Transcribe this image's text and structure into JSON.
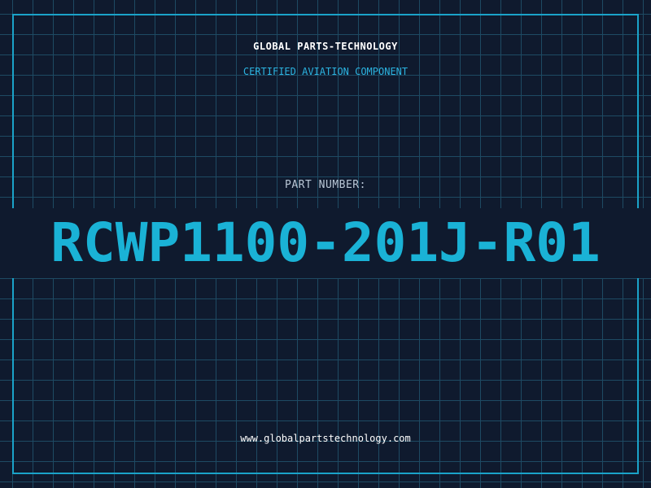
{
  "header": {
    "company": "GLOBAL PARTS-TECHNOLOGY",
    "subtitle": "CERTIFIED AVIATION COMPONENT"
  },
  "part": {
    "label": "PART NUMBER:",
    "number": "RCWP1100-201J-R01"
  },
  "footer": {
    "website": "www.globalpartstechnology.com"
  },
  "colors": {
    "background": "#0f1a2e",
    "grid": "#1e4a63",
    "accent": "#1ab2d6",
    "frame": "#1aa3c9"
  }
}
